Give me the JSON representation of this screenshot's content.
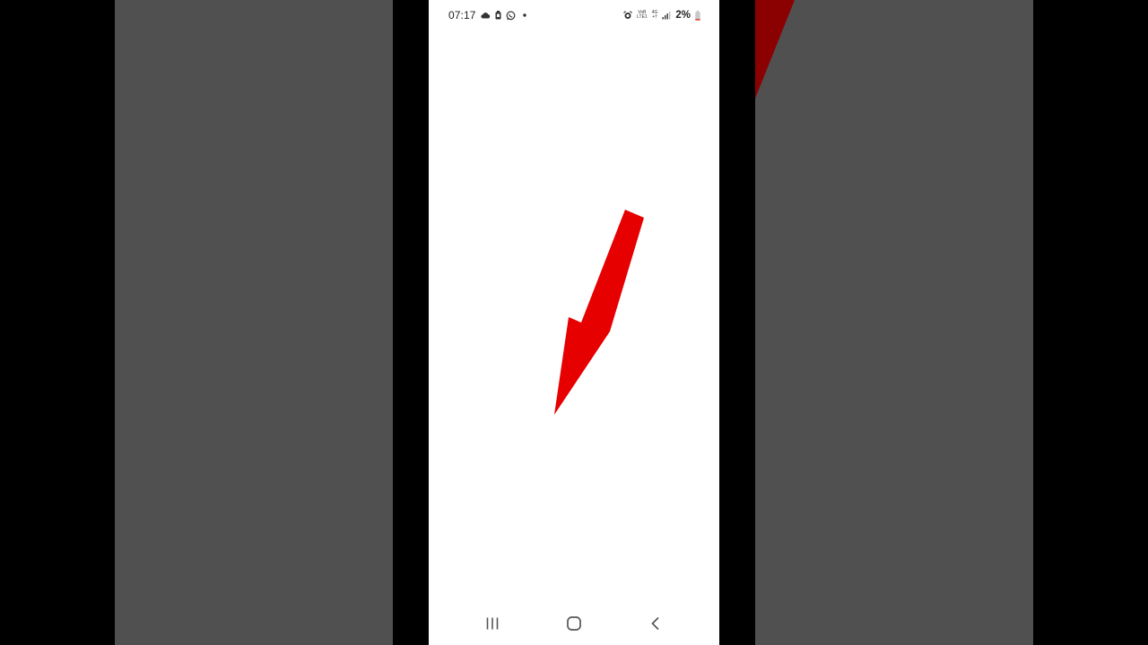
{
  "status_bar": {
    "time": "07:17",
    "left_icons": [
      "cloud-icon",
      "battery-saver-icon",
      "whatsapp-icon",
      "notification-dot-icon"
    ],
    "volte_label_top": "VoB",
    "volte_label_bottom": "LTE1",
    "network_top": "4G",
    "network_bottom": "+†",
    "battery_percent": "2%",
    "right_icons": [
      "alarm-icon",
      "signal-icon",
      "battery-low-icon"
    ]
  },
  "colors": {
    "arrow_red": "#e60000",
    "background_gray": "#505050",
    "right_accent": "#8b0000",
    "screen_white": "#ffffff"
  },
  "nav_bar": {
    "buttons": [
      "recent-apps-icon",
      "home-icon",
      "back-icon"
    ]
  }
}
